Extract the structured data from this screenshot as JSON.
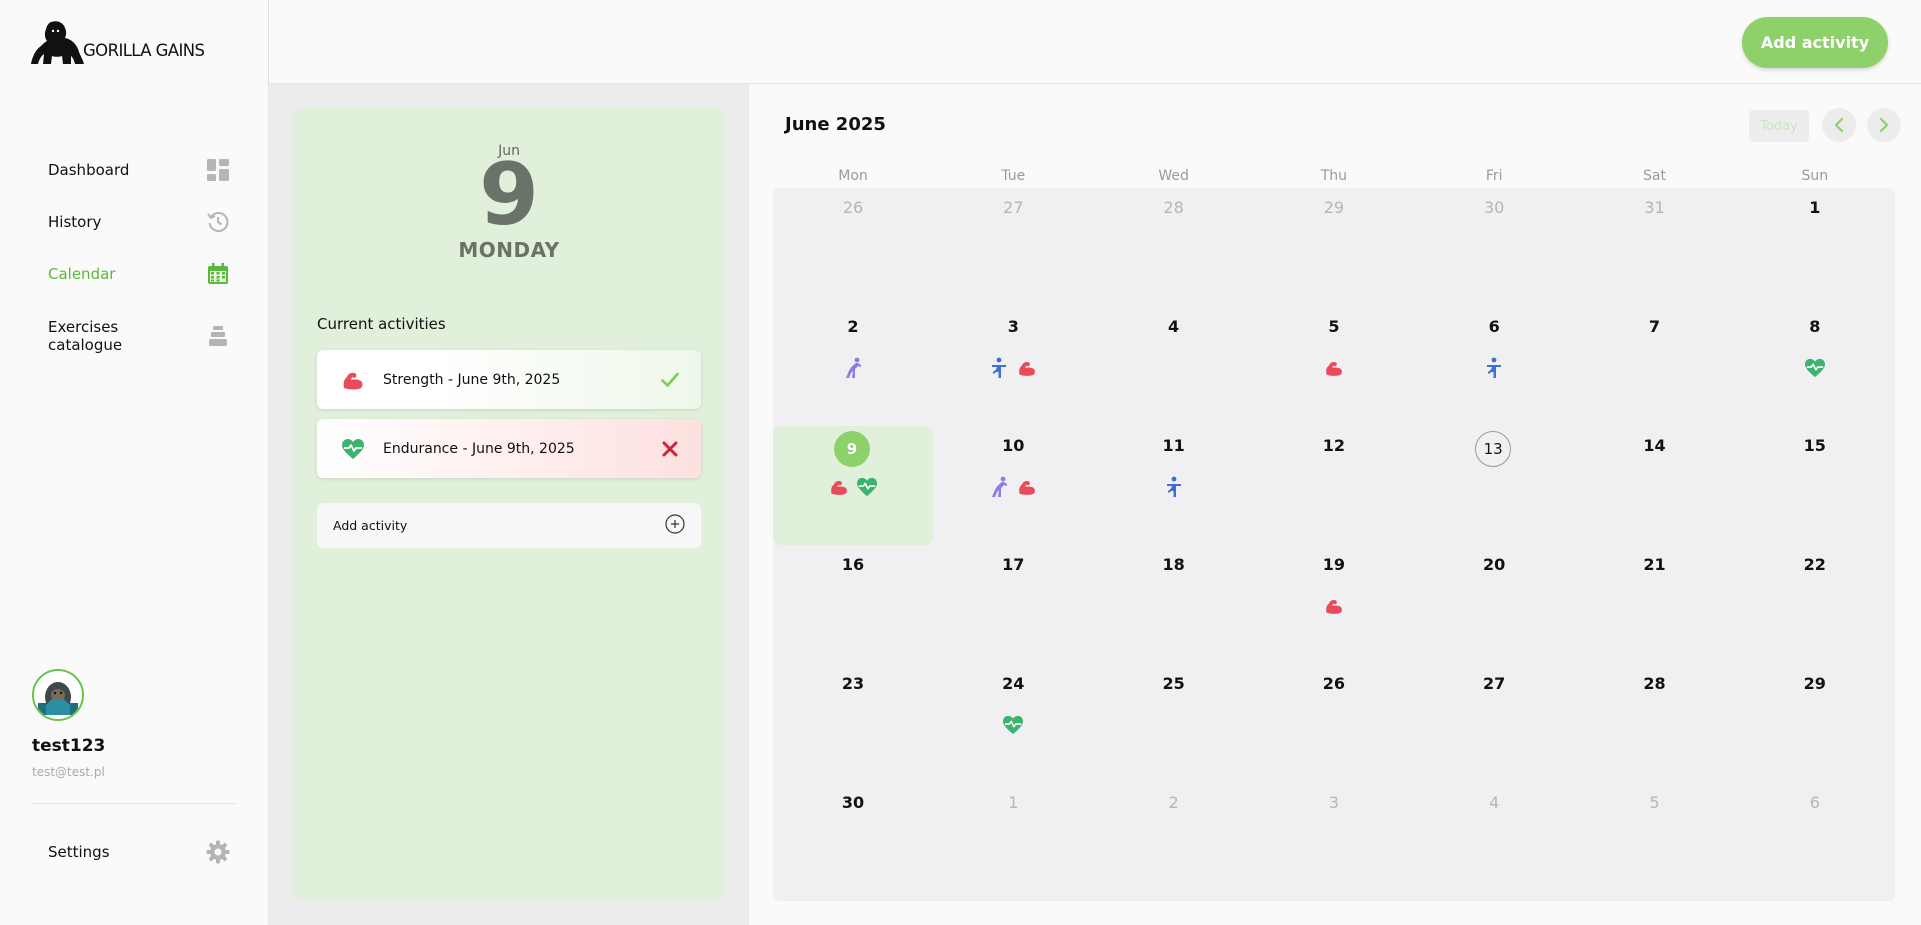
{
  "app": {
    "brand": "GORILLA GAINS"
  },
  "nav": {
    "dashboard": "Dashboard",
    "history": "History",
    "calendar": "Calendar",
    "exercises_line1": "Exercises",
    "exercises_line2": "catalogue"
  },
  "user": {
    "name": "test123",
    "email": "test@test.pl"
  },
  "settings_label": "Settings",
  "header": {
    "add_activity_label": "Add activity"
  },
  "colors": {
    "accent": "#8ed06a",
    "accent_text": "#5ab83a",
    "strength": "#e94b5a",
    "endurance": "#3bb56d",
    "flexibility": "#8a7fe0",
    "balance": "#3d6fd8",
    "fail": "#c9243a"
  },
  "day": {
    "month": "Jun",
    "number": "9",
    "weekday": "MONDAY"
  },
  "current": {
    "title": "Current activities",
    "items": [
      {
        "label": "Strength - June 9th, 2025",
        "icon": "flexed-biceps-icon",
        "status": "done"
      },
      {
        "label": "Endurance - June 9th, 2025",
        "icon": "heart-pulse-icon",
        "status": "failed"
      }
    ],
    "add_label": "Add activity"
  },
  "calendar": {
    "title": "June 2025",
    "today_label": "Today",
    "weekdays": [
      "Mon",
      "Tue",
      "Wed",
      "Thu",
      "Fri",
      "Sat",
      "Sun"
    ],
    "weeks": [
      [
        {
          "d": "26",
          "other": true
        },
        {
          "d": "27",
          "other": true
        },
        {
          "d": "28",
          "other": true
        },
        {
          "d": "29",
          "other": true
        },
        {
          "d": "30",
          "other": true
        },
        {
          "d": "31",
          "other": true
        },
        {
          "d": "1"
        }
      ],
      [
        {
          "d": "2",
          "act": [
            "flexibility"
          ]
        },
        {
          "d": "3",
          "act": [
            "balance",
            "strength"
          ]
        },
        {
          "d": "4"
        },
        {
          "d": "5",
          "act": [
            "strength"
          ]
        },
        {
          "d": "6",
          "act": [
            "balance"
          ]
        },
        {
          "d": "7"
        },
        {
          "d": "8",
          "act": [
            "endurance"
          ]
        }
      ],
      [
        {
          "d": "9",
          "selected": true,
          "act": [
            "strength",
            "endurance"
          ]
        },
        {
          "d": "10",
          "act": [
            "flexibility",
            "strength"
          ]
        },
        {
          "d": "11",
          "act": [
            "balance"
          ]
        },
        {
          "d": "12"
        },
        {
          "d": "13",
          "today": true
        },
        {
          "d": "14"
        },
        {
          "d": "15"
        }
      ],
      [
        {
          "d": "16"
        },
        {
          "d": "17"
        },
        {
          "d": "18"
        },
        {
          "d": "19",
          "act": [
            "strength"
          ]
        },
        {
          "d": "20"
        },
        {
          "d": "21"
        },
        {
          "d": "22"
        }
      ],
      [
        {
          "d": "23"
        },
        {
          "d": "24",
          "act": [
            "endurance"
          ]
        },
        {
          "d": "25"
        },
        {
          "d": "26"
        },
        {
          "d": "27"
        },
        {
          "d": "28"
        },
        {
          "d": "29"
        }
      ],
      [
        {
          "d": "30"
        },
        {
          "d": "1",
          "other": true
        },
        {
          "d": "2",
          "other": true
        },
        {
          "d": "3",
          "other": true
        },
        {
          "d": "4",
          "other": true
        },
        {
          "d": "5",
          "other": true
        },
        {
          "d": "6",
          "other": true
        }
      ]
    ]
  }
}
